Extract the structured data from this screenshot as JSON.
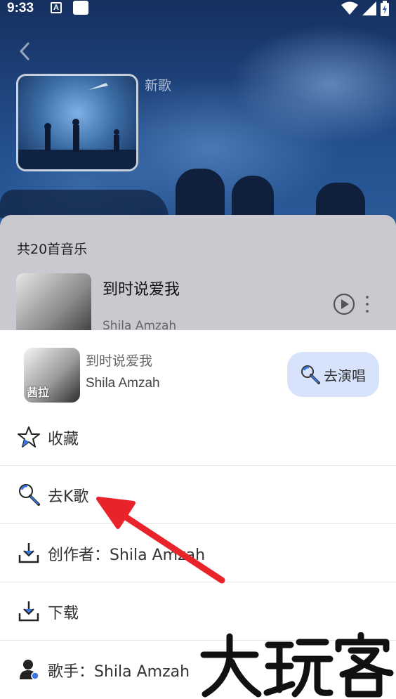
{
  "status_bar": {
    "time": "9:33",
    "notice_icon": "A"
  },
  "header": {
    "playlist_title": "新歌"
  },
  "song_list": {
    "count_label": "共20首音乐",
    "first_song": {
      "title": "到时说爱我",
      "artist": "Shila Amzah"
    }
  },
  "sheet": {
    "song_title": "到时说爱我",
    "song_artist": "Shila Amzah",
    "thumb_label": "茜拉",
    "sing_button_label": "去演唱",
    "menu": [
      {
        "label": "收藏",
        "icon": "star-icon"
      },
      {
        "label": "去K歌",
        "icon": "microphone-icon"
      },
      {
        "label": "创作者：Shila Amzah",
        "icon": "download-icon"
      },
      {
        "label": "下载",
        "icon": "download-icon"
      },
      {
        "label": "歌手：Shila Amzah",
        "icon": "person-icon"
      }
    ]
  },
  "watermark_text": "大玩客",
  "colors": {
    "accent_blue": "#3a78e6",
    "sing_button_bg": "#d6e3fb",
    "arrow_red": "#e8232a"
  }
}
